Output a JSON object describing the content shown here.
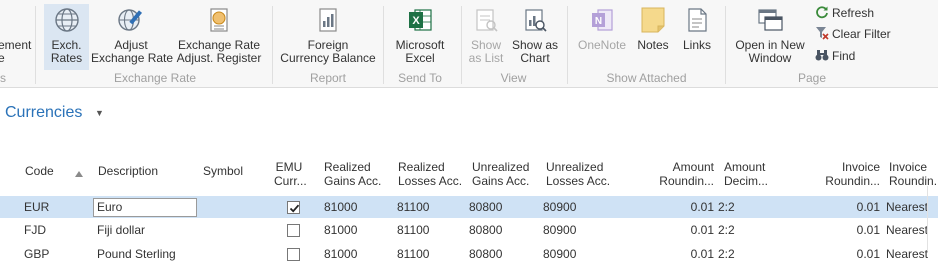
{
  "ribbon": {
    "partial_left": {
      "line1": "ement",
      "line2": "e",
      "group_tail": "s"
    },
    "buttons": {
      "exch_rates": {
        "line1": "Exch.",
        "line2": "Rates"
      },
      "adjust_exchange_rate": {
        "line1": "Adjust",
        "line2": "Exchange Rate"
      },
      "exchange_rate_register": {
        "line1": "Exchange Rate",
        "line2": "Adjust. Register"
      },
      "foreign_currency_balance": {
        "line1": "Foreign",
        "line2": "Currency Balance"
      },
      "microsoft_excel": {
        "line1": "Microsoft",
        "line2": "Excel"
      },
      "show_as_list": {
        "line1": "Show",
        "line2": "as List"
      },
      "show_as_chart": {
        "line1": "Show as",
        "line2": "Chart"
      },
      "onenote": {
        "line1": "OneNote"
      },
      "notes": {
        "line1": "Notes"
      },
      "links": {
        "line1": "Links"
      },
      "open_in_new_window": {
        "line1": "Open in New",
        "line2": "Window"
      },
      "refresh": "Refresh",
      "clear_filter": "Clear Filter",
      "find": "Find"
    },
    "groups": {
      "exchange_rate": "Exchange Rate",
      "report": "Report",
      "send_to": "Send To",
      "view": "View",
      "show_attached": "Show Attached",
      "page": "Page"
    },
    "colors": {
      "excel_green": "#1e7145",
      "onenote_purple": "#b4a0d8",
      "notes_yellow": "#f5d98c"
    }
  },
  "page": {
    "title": "Currencies",
    "title_color": "#2a72b8"
  },
  "grid": {
    "headers": {
      "code": "Code",
      "description": "Description",
      "symbol": "Symbol",
      "emu_l1": "EMU",
      "emu_l2": "Curr...",
      "rga_l1": "Realized",
      "rga_l2": "Gains Acc.",
      "rla_l1": "Realized",
      "rla_l2": "Losses Acc.",
      "uga_l1": "Unrealized",
      "uga_l2": "Gains Acc.",
      "ula_l1": "Unrealized",
      "ula_l2": "Losses Acc.",
      "ar_l1": "Amount",
      "ar_l2": "Roundin...",
      "ad_l1": "Amount",
      "ad_l2": "Decim...",
      "ir_l1": "Invoice",
      "ir_l2": "Roundin...",
      "irt_l1": "Invoice",
      "irt_l2": "Roundin..."
    },
    "rows": [
      {
        "code": "EUR",
        "description": "Euro",
        "symbol": "",
        "emu": true,
        "rga": "81000",
        "rla": "81100",
        "uga": "80800",
        "ula": "80900",
        "amount_rounding": "0.01",
        "amount_decimals": "2:2",
        "invoice_rounding": "0.01",
        "invoice_rounding_type": "Nearest"
      },
      {
        "code": "FJD",
        "description": "Fiji dollar",
        "symbol": "",
        "emu": false,
        "rga": "81000",
        "rla": "81100",
        "uga": "80800",
        "ula": "80900",
        "amount_rounding": "0.01",
        "amount_decimals": "2:2",
        "invoice_rounding": "0.01",
        "invoice_rounding_type": "Nearest"
      },
      {
        "code": "GBP",
        "description": "Pound Sterling",
        "symbol": "",
        "emu": false,
        "rga": "81000",
        "rla": "81100",
        "uga": "80800",
        "ula": "80900",
        "amount_rounding": "0.01",
        "amount_decimals": "2:2",
        "invoice_rounding": "0.01",
        "invoice_rounding_type": "Nearest"
      }
    ]
  }
}
